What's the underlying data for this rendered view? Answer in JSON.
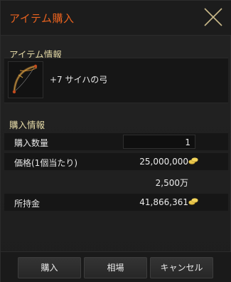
{
  "window": {
    "title": "アイテム購入",
    "title_color": "#e8621f"
  },
  "item_info": {
    "section_label": "アイテム情報",
    "item_name": "+7 サイハの弓",
    "item_icon": "bow-icon"
  },
  "purchase_info": {
    "section_label": "購入情報",
    "quantity_label": "購入数量",
    "quantity_value": "1",
    "price_label": "価格(1個当たり)",
    "price_value": "25,000,000",
    "price_abbrev": "2,500万",
    "money_label": "所持金",
    "money_value": "41,866,361",
    "currency_icon": "silver-coins-icon"
  },
  "buttons": {
    "buy": "購入",
    "market": "相場",
    "cancel": "キャンセル"
  }
}
